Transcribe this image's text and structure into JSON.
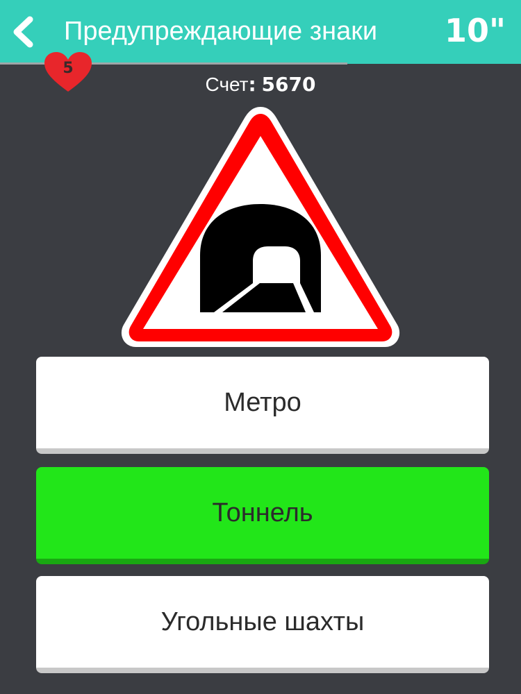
{
  "header": {
    "title": "Предупреждающие знаки",
    "timer": "10\""
  },
  "lives": {
    "count": "5"
  },
  "score": {
    "label": "Счет",
    "separator": ":",
    "value": "5670"
  },
  "answers": [
    {
      "label": "Метро",
      "state": "default"
    },
    {
      "label": "Тоннель",
      "state": "correct"
    },
    {
      "label": "Угольные шахты",
      "state": "default"
    }
  ],
  "colors": {
    "header": "#35cfba",
    "background": "#3b3d42",
    "correct": "#22e619",
    "heart": "#e8262b",
    "sign_border": "#ff0000"
  },
  "icons": {
    "back": "chevron-left-icon",
    "lives": "heart-icon",
    "sign": "tunnel-warning-sign"
  }
}
